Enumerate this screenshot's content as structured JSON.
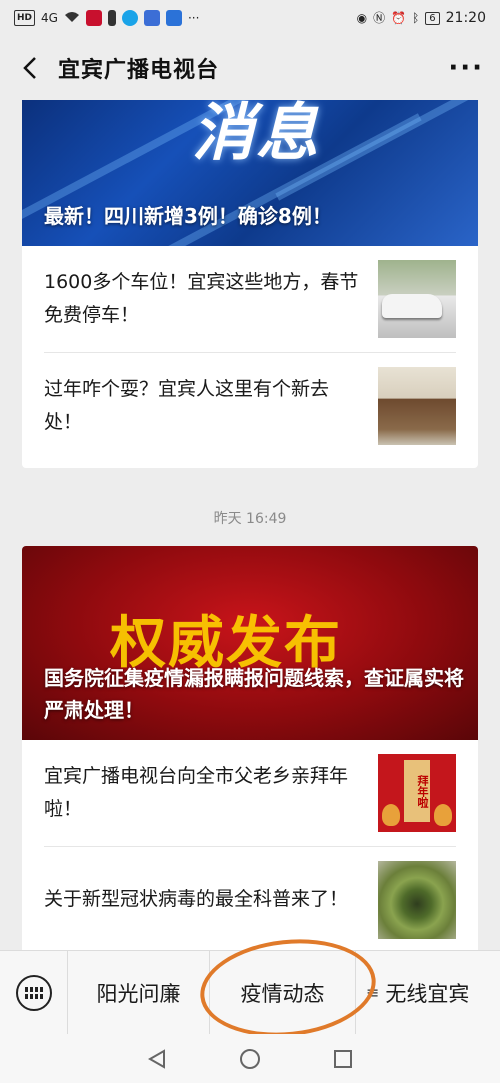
{
  "status_bar": {
    "network": "HD",
    "signal": "4G",
    "time": "21:20",
    "battery": "6",
    "icons": [
      "eye-icon",
      "nfc-icon",
      "alarm-icon",
      "bluetooth-icon"
    ]
  },
  "header": {
    "title": "宜宾广播电视台"
  },
  "messages": [
    {
      "cover_title": "最新！四川新增3例！确诊8例！",
      "cover_banner": "消息",
      "items": [
        {
          "text": "1600多个车位！宜宾这些地方，春节免费停车！",
          "thumb": "car-photo"
        },
        {
          "text": "过年咋个耍？宜宾人这里有个新去处！",
          "thumb": "storefront-photo"
        }
      ]
    },
    {
      "timestamp": "昨天 16:49",
      "cover_title": "国务院征集疫情漏报瞒报问题线索，查证属实将严肃处理！",
      "cover_banner": "权威发布",
      "items": [
        {
          "text": "宜宾广播电视台向全市父老乡亲拜年啦！",
          "thumb": "new-year-greeting",
          "thumb_text": "拜年啦"
        },
        {
          "text": "关于新型冠状病毒的最全科普来了！",
          "thumb": "virus-image"
        }
      ]
    }
  ],
  "menu": {
    "items": [
      "阳光问廉",
      "疫情动态",
      "无线宜宾"
    ],
    "highlight_color": "#e07a2a"
  }
}
